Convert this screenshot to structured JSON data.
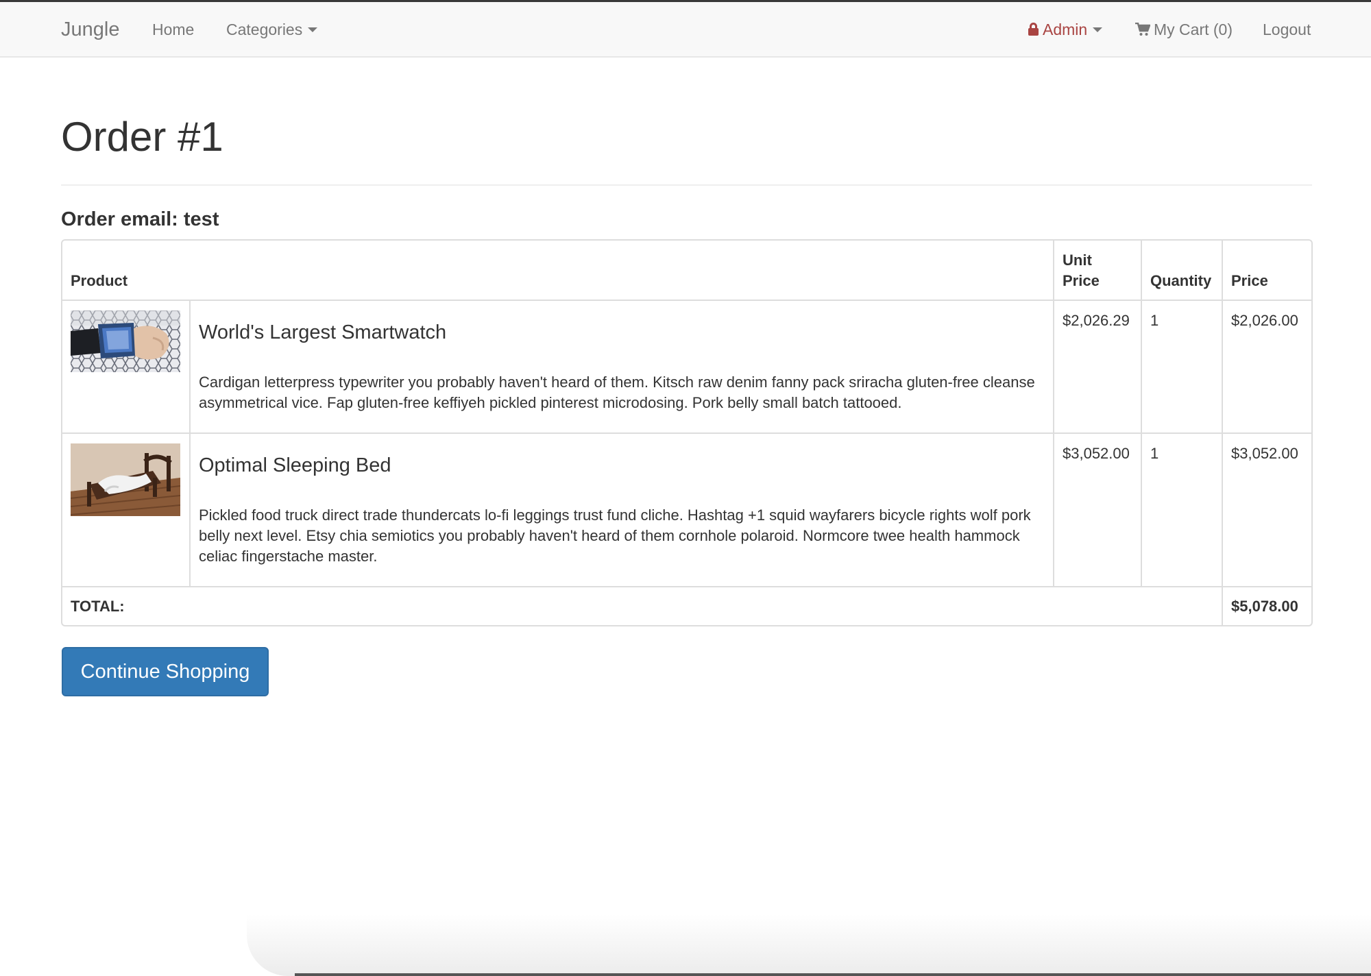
{
  "navbar": {
    "brand": "Jungle",
    "home": "Home",
    "categories": "Categories",
    "admin": "Admin",
    "cart": "My Cart (0)",
    "logout": "Logout"
  },
  "page": {
    "title": "Order #1",
    "email_line": "Order email: test"
  },
  "table": {
    "headers": {
      "product": "Product",
      "unit_price": "Unit Price",
      "quantity": "Quantity",
      "price": "Price"
    },
    "rows": [
      {
        "name": "World's Largest Smartwatch",
        "description": "Cardigan letterpress typewriter you probably haven't heard of them. Kitsch raw denim fanny pack sriracha gluten-free cleanse asymmetrical vice. Fap gluten-free keffiyeh pickled pinterest microdosing. Pork belly small batch tattooed.",
        "unit_price": "$2,026.29",
        "quantity": "1",
        "price": "$2,026.00"
      },
      {
        "name": "Optimal Sleeping Bed",
        "description": "Pickled food truck direct trade thundercats lo-fi leggings trust fund cliche. Hashtag +1 squid wayfarers bicycle rights wolf pork belly next level. Etsy chia semiotics you probably haven't heard of them cornhole polaroid. Normcore twee health hammock celiac fingerstache master.",
        "unit_price": "$3,052.00",
        "quantity": "1",
        "price": "$3,052.00"
      }
    ],
    "total_label": "TOTAL:",
    "total_value": "$5,078.00"
  },
  "actions": {
    "continue_shopping": "Continue Shopping"
  },
  "colors": {
    "navbar_bg": "#f8f8f8",
    "admin_red": "#a94442",
    "primary_button": "#337ab7",
    "border": "#dddddd"
  }
}
